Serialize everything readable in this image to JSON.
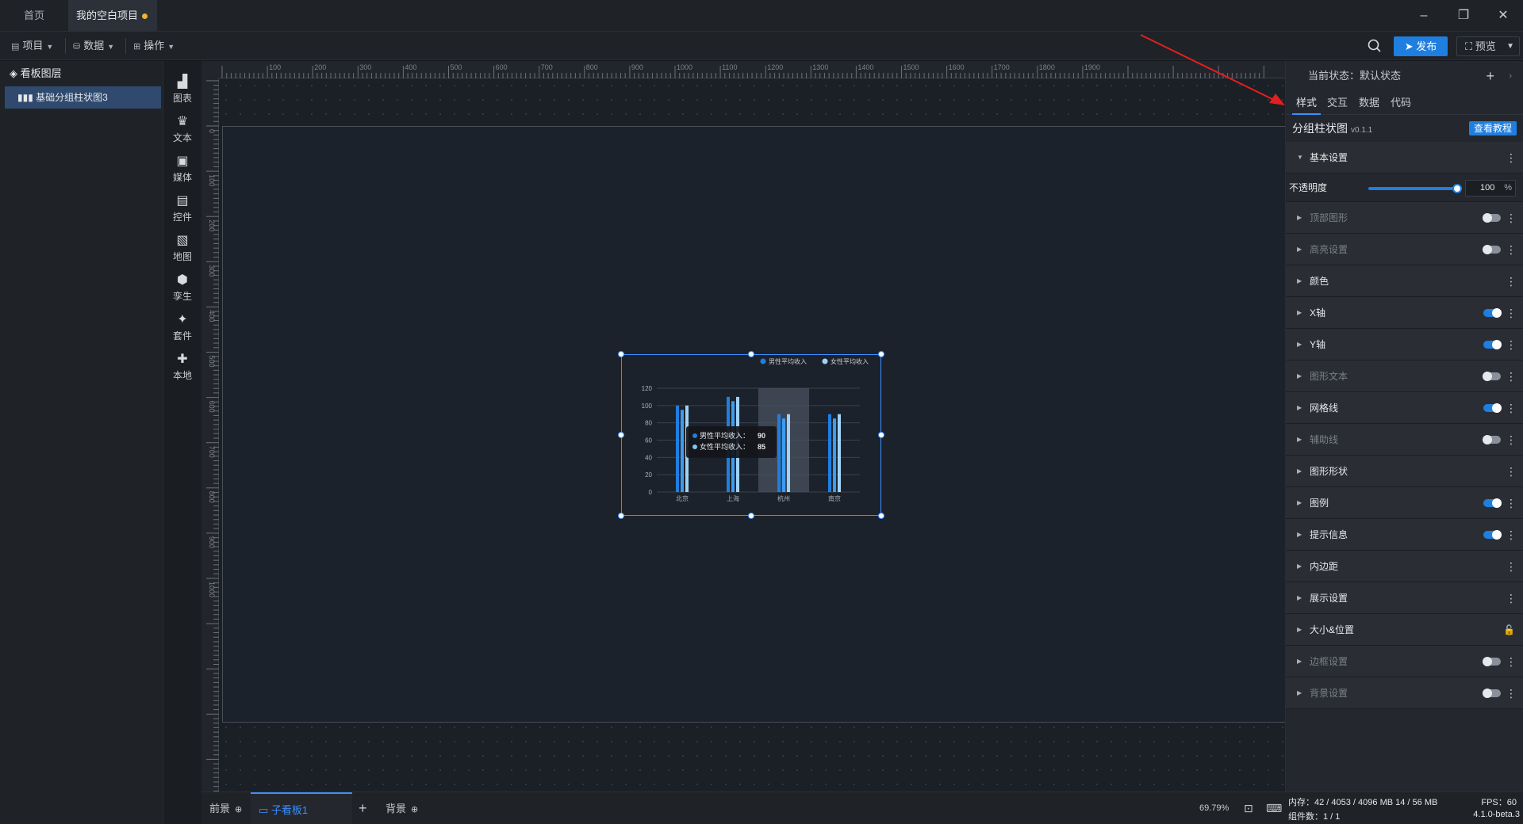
{
  "tabs": [
    {
      "label": "首页"
    },
    {
      "label": "我的空白项目"
    }
  ],
  "toolbar": {
    "project_menu": "项目",
    "data_menu": "数据",
    "ops_menu": "操作",
    "publish_label": "发布",
    "preview_label": "预览"
  },
  "layers": {
    "title": "看板图层",
    "items": [
      {
        "label": "基础分组柱状图3"
      }
    ]
  },
  "components": [
    {
      "label": "图表",
      "icon": "bar-chart-icon"
    },
    {
      "label": "文本",
      "icon": "text-icon"
    },
    {
      "label": "媒体",
      "icon": "media-icon"
    },
    {
      "label": "控件",
      "icon": "control-icon"
    },
    {
      "label": "地图",
      "icon": "map-icon"
    },
    {
      "label": "孪生",
      "icon": "twin-icon"
    },
    {
      "label": "套件",
      "icon": "kit-icon"
    },
    {
      "label": "本地",
      "icon": "puzzle-icon"
    }
  ],
  "ruler": {
    "top_ticks": [
      "0",
      "100",
      "200",
      "300",
      "400",
      "500",
      "600",
      "700",
      "800",
      "900",
      "1000",
      "1100",
      "1200",
      "1300",
      "1400",
      "1500",
      "1600",
      "1700",
      "1800",
      "1900"
    ],
    "left_ticks": [
      "0",
      "100",
      "200",
      "300",
      "400",
      "500",
      "600",
      "700",
      "800",
      "900",
      "1000"
    ]
  },
  "chart_data": {
    "type": "bar",
    "categories": [
      "北京",
      "上海",
      "杭州",
      "南京"
    ],
    "series": [
      {
        "name": "男性平均收入",
        "values": [
          100,
          110,
          90,
          90
        ],
        "color": "#1f7fe0"
      },
      {
        "name": "",
        "values": [
          95,
          105,
          85,
          85
        ],
        "color": "#3a9df2"
      },
      {
        "name": "女性平均收入",
        "values": [
          100,
          110,
          90,
          90
        ],
        "color": "#9fd3f5"
      }
    ],
    "y_ticks": [
      "0",
      "20",
      "40",
      "60",
      "80",
      "100",
      "120"
    ],
    "ylim": [
      0,
      120
    ],
    "legend_position": "top-right",
    "grid": true,
    "highlight_category": "杭州"
  },
  "tooltip": {
    "row1_label": "男性平均收入：",
    "row1_value": "90",
    "row2_label": "女性平均收入：",
    "row2_value": "85"
  },
  "bottom": {
    "front": "前景",
    "sub_board": "子看板1",
    "background": "背景",
    "zoom": "69.79%"
  },
  "panel": {
    "state_label": "当前状态：默认状态",
    "tabs": [
      "样式",
      "交互",
      "数据",
      "代码"
    ],
    "component_title": "分组柱状图",
    "version": "v0.1.1",
    "tutorial_label": "查看教程",
    "basic_group": "基本设置",
    "opacity_label": "不透明度",
    "opacity_value": "100",
    "opacity_unit": "%",
    "groups": [
      {
        "label": "顶部图形",
        "toggle": "off",
        "disabled": true
      },
      {
        "label": "高亮设置",
        "toggle": "off",
        "disabled": true
      },
      {
        "label": "颜色",
        "toggle": "none",
        "disabled": false
      },
      {
        "label": "X轴",
        "toggle": "on",
        "disabled": false
      },
      {
        "label": "Y轴",
        "toggle": "on",
        "disabled": false
      },
      {
        "label": "图形文本",
        "toggle": "off",
        "disabled": true
      },
      {
        "label": "网格线",
        "toggle": "on",
        "disabled": false
      },
      {
        "label": "辅助线",
        "toggle": "off",
        "disabled": true
      },
      {
        "label": "图形形状",
        "toggle": "none",
        "disabled": false
      },
      {
        "label": "图例",
        "toggle": "on",
        "disabled": false
      },
      {
        "label": "提示信息",
        "toggle": "on",
        "disabled": false
      },
      {
        "label": "内边距",
        "toggle": "none",
        "disabled": false
      },
      {
        "label": "展示设置",
        "toggle": "none",
        "disabled": false
      },
      {
        "label": "大小&位置",
        "toggle": "lock",
        "disabled": false
      },
      {
        "label": "边框设置",
        "toggle": "off",
        "disabled": true
      },
      {
        "label": "背景设置",
        "toggle": "off",
        "disabled": true
      }
    ]
  },
  "status": {
    "memory": "内存：42 / 4053 / 4096 MB  14 / 56 MB",
    "fps": "FPS：60",
    "count": "组件数：1 / 1",
    "version": "4.1.0-beta.3"
  },
  "colors": {
    "accent": "#1f7fe0",
    "annotation_arrow": "#e02020"
  }
}
